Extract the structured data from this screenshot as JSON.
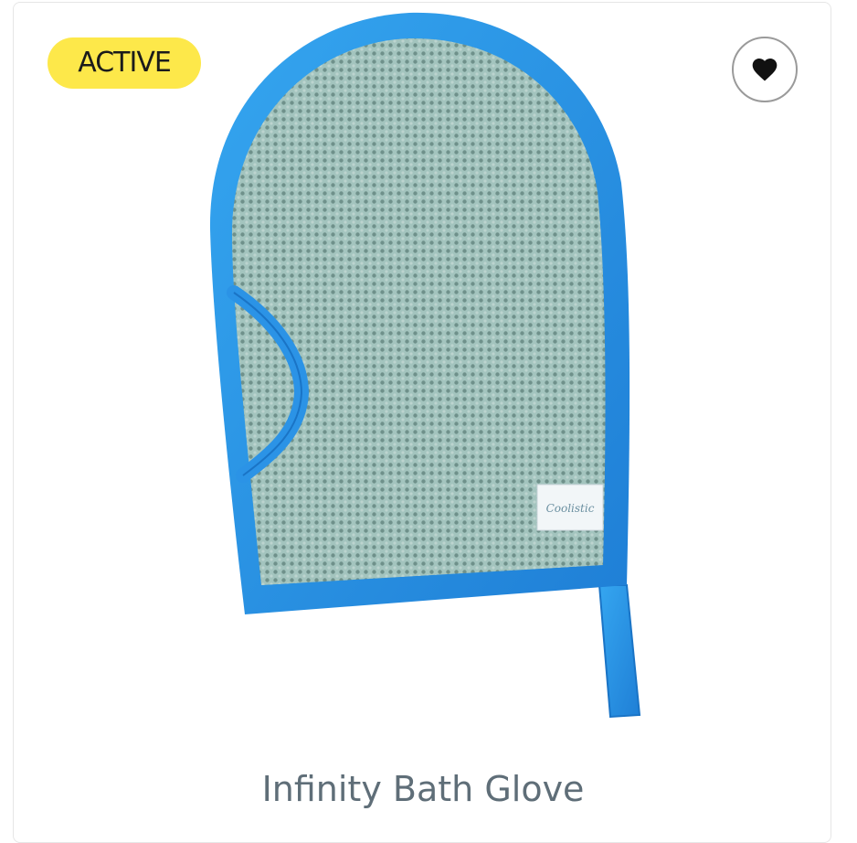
{
  "product": {
    "status_badge": "ACTIVE",
    "name": "Infinity Bath Glove",
    "label_tag_text": "Coolistic",
    "image_icon": "bath-glove-mitt",
    "favorite_icon": "heart-icon"
  },
  "colors": {
    "badge_bg": "#fde84a",
    "glove_trim": "#2a8fe0",
    "glove_mesh": "#8fb3ad",
    "title_text": "#5f6e78"
  }
}
